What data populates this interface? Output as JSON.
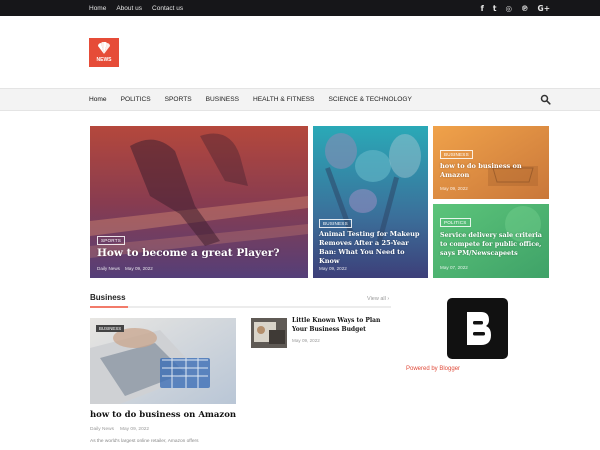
{
  "topbar": {
    "links": [
      "Home",
      "About us",
      "Contact us"
    ],
    "social_icons": [
      "facebook-icon",
      "twitter-icon",
      "instagram-icon",
      "pinterest-icon",
      "google-plus-icon"
    ],
    "social_glyphs": [
      "f",
      "t",
      "◎",
      "℗",
      "G+"
    ]
  },
  "logo": {
    "text": "NEWS",
    "color": "#e64c38"
  },
  "nav": {
    "items": [
      "Home",
      "POLITICS",
      "SPORTS",
      "BUSINESS",
      "HEALTH & FITNESS",
      "SCIENCE & TECHNOLOGY"
    ],
    "search_icon": "search-icon"
  },
  "featured": [
    {
      "tag": "SPORTS",
      "title": "How to become a great Player?",
      "author": "Daily News",
      "date": "May 09, 2022"
    },
    {
      "tag": "BUSINESS",
      "title": "Animal Testing for Makeup Removes After a 25-Year Ban: What You Need to Know",
      "date": "May 09, 2022"
    },
    {
      "tag": "BUSINESS",
      "title": "how to do business on Amazon",
      "date": "May 09, 2022"
    },
    {
      "tag": "POLITICS",
      "title": "Service delivery sale criteria to compete for public office, says PM/Newscapeets",
      "date": "May 07, 2022"
    }
  ],
  "business": {
    "title": "Business",
    "view_all": "View all ›",
    "main": {
      "tag": "BUSINESS",
      "title": "how to do business on Amazon",
      "author": "Daily News",
      "date": "May 09, 2022",
      "snippet": "As the world's largest online retailer, Amazon offers"
    },
    "side": {
      "title": "Little Known Ways to Plan Your Business Budget",
      "date": "May 09, 2022"
    }
  },
  "widget": {
    "powered_by": "Powered by Blogger",
    "icon": "blogger-logo-icon"
  },
  "colors": {
    "accent": "#e64c38",
    "topbar": "#161619",
    "nav_bg": "#f3f3f3"
  }
}
